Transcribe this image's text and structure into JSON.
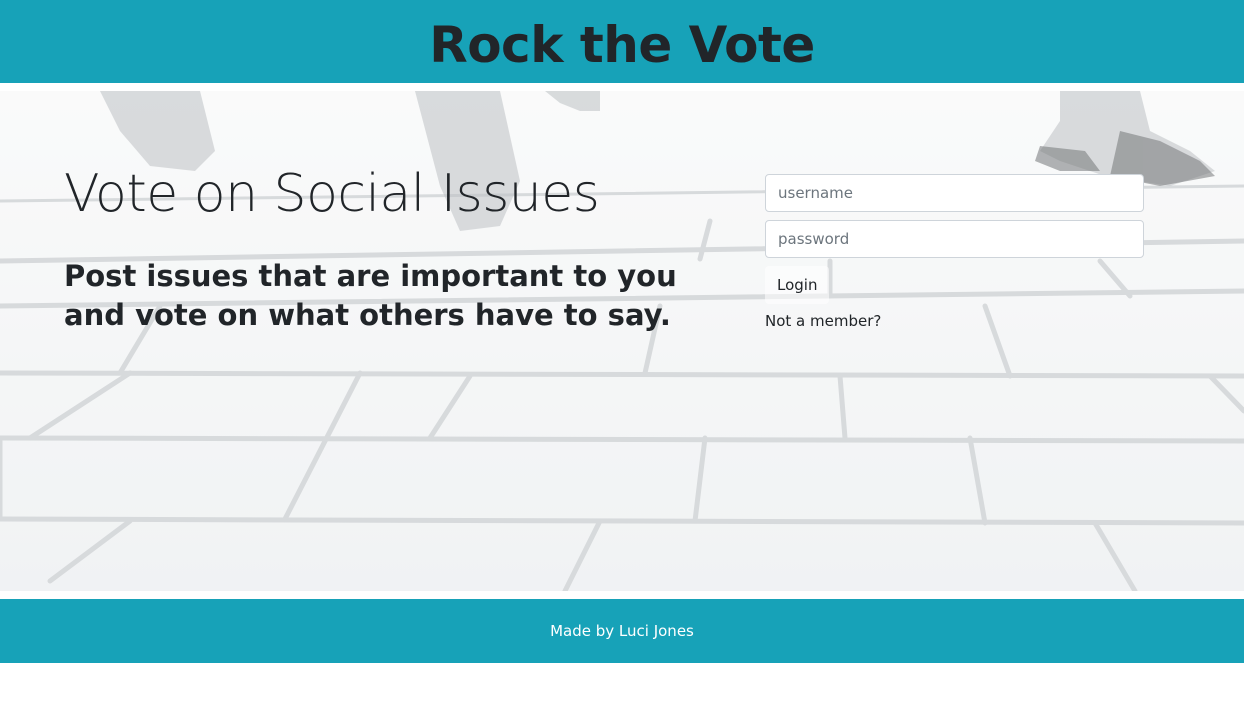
{
  "header": {
    "title": "Rock the Vote"
  },
  "hero": {
    "heading": "Vote on Social Issues",
    "lead": "Post issues that are important to you and vote on what others have to say."
  },
  "login": {
    "username_placeholder": "username",
    "username_value": "",
    "password_placeholder": "password",
    "password_value": "",
    "button_label": "Login",
    "signup_link": "Not a member?"
  },
  "footer": {
    "text": "Made by Luci Jones"
  },
  "colors": {
    "brand": "#17a2b8",
    "text": "#212529",
    "footer_text": "#ffffff"
  }
}
